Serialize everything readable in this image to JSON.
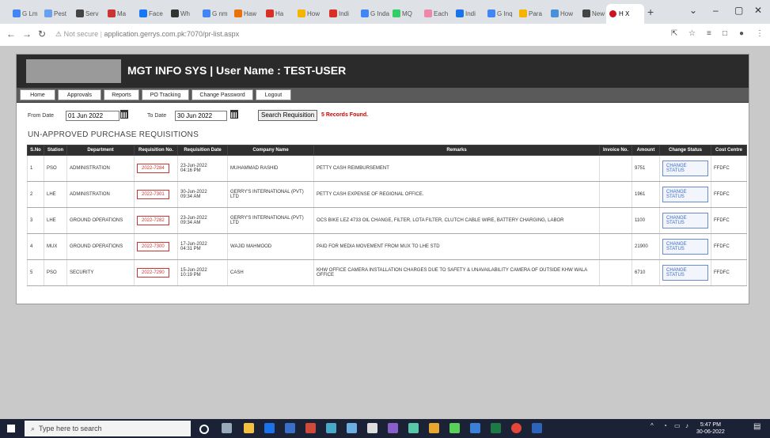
{
  "browser": {
    "tabs": [
      {
        "label": "G Lm",
        "color": "#4285f4"
      },
      {
        "label": "Pest",
        "color": "#6aa0f0"
      },
      {
        "label": "Serv",
        "color": "#444"
      },
      {
        "label": "Ma",
        "color": "#c33"
      },
      {
        "label": "Face",
        "color": "#1877f2"
      },
      {
        "label": "Wh",
        "color": "#333"
      },
      {
        "label": "G nm",
        "color": "#4285f4"
      },
      {
        "label": "Haw",
        "color": "#e8710a"
      },
      {
        "label": "Ha",
        "color": "#d93025"
      },
      {
        "label": "How",
        "color": "#f4b400"
      },
      {
        "label": "Indi",
        "color": "#d93025"
      },
      {
        "label": "G Inda",
        "color": "#4285f4"
      },
      {
        "label": "MQ",
        "color": "#3c6"
      },
      {
        "label": "Each",
        "color": "#e8a"
      },
      {
        "label": "Indi",
        "color": "#1a73e8"
      },
      {
        "label": "G Inq",
        "color": "#4285f4"
      },
      {
        "label": "Para",
        "color": "#f4b400"
      },
      {
        "label": "How",
        "color": "#4a90d9"
      },
      {
        "label": "New",
        "color": "#444"
      }
    ],
    "active_tab": "H X",
    "url_prefix": "Not secure",
    "url": "application.gerrys.com.pk:7070/pr-list.aspx"
  },
  "app": {
    "title": "MGT INFO SYS | User Name : TEST-USER",
    "menu": [
      "Home",
      "Approvals",
      "Reports",
      "PO Tracking",
      "Change Password",
      "Logout"
    ],
    "filter": {
      "from_label": "From Date",
      "from_value": "01 Jun 2022",
      "to_label": "To Date",
      "to_value": "30 Jun 2022",
      "search_label": "Search Requisition",
      "records_found": "5 Records Found."
    },
    "section_title": "UN-APPROVED PURCHASE REQUISITIONS",
    "columns": [
      "S.No",
      "Station",
      "Department",
      "Requisition No.",
      "Requisition Date",
      "Company Name",
      "Remarks",
      "Invoice No.",
      "Amount",
      "Change Status",
      "Cost Centre"
    ],
    "rows": [
      {
        "sno": "1",
        "station": "PSO",
        "department": "ADMINISTRATION",
        "req_no": "2022-7284",
        "req_date": "23-Jun-2022",
        "req_time": "04:16 PM",
        "company": "MUHAMMAD RASHID",
        "remarks": "PETTY CASH REIMBURSEMENT",
        "invoice": "",
        "amount": "9751",
        "status": "CHANGE STATUS",
        "cost_centre": "FFDFC"
      },
      {
        "sno": "2",
        "station": "LHE",
        "department": "ADMINISTRATION",
        "req_no": "2022-7301",
        "req_date": "30-Jun-2022",
        "req_time": "09:34 AM",
        "company": "GERRY'S INTERNATIONAL (PVT) LTD",
        "remarks": "PETTY CASH EXPENSE OF REGIONAL OFFICE.",
        "invoice": "",
        "amount": "1961",
        "status": "CHANGE STATUS",
        "cost_centre": "FFDFC"
      },
      {
        "sno": "3",
        "station": "LHE",
        "department": "GROUND OPERATIONS",
        "req_no": "2022-7282",
        "req_date": "23-Jun-2022",
        "req_time": "09:34 AM",
        "company": "GERRY'S INTERNATIONAL (PVT) LTD",
        "remarks": "OCS BIKE LEZ 4733 OIL CHANGE, FILTER, LOTA FILTER, CLUTCH CABLE WIRE, BATTERY CHARGING, LABOR",
        "invoice": "",
        "amount": "1100",
        "status": "CHANGE STATUS",
        "cost_centre": "FFDFC"
      },
      {
        "sno": "4",
        "station": "MUX",
        "department": "GROUND OPERATIONS",
        "req_no": "2022-7300",
        "req_date": "17-Jun-2022",
        "req_time": "04:31 PM",
        "company": "WAJID MAHMOOD",
        "remarks": "PAID FOR MEDIA MOVEMENT FROM MUX TO LHE STD",
        "invoice": "",
        "amount": "21900",
        "status": "CHANGE STATUS",
        "cost_centre": "FFDFC"
      },
      {
        "sno": "5",
        "station": "PSO",
        "department": "SECURITY",
        "req_no": "2022-7290",
        "req_date": "15-Jun-2022",
        "req_time": "10:19 PM",
        "company": "CASH",
        "remarks": "KHW OFFICE CAMERA INSTALLATION CHARGES DUE TO SAFETY & UNAVAILABILITY CAMERA OF OUTSIDE KHW WALA OFFICE",
        "invoice": "",
        "amount": "6710",
        "status": "CHANGE STATUS",
        "cost_centre": "FFDFC"
      }
    ]
  },
  "taskbar": {
    "search_placeholder": "Type here to search",
    "time": "5:47 PM",
    "date": "30-06-2022"
  }
}
